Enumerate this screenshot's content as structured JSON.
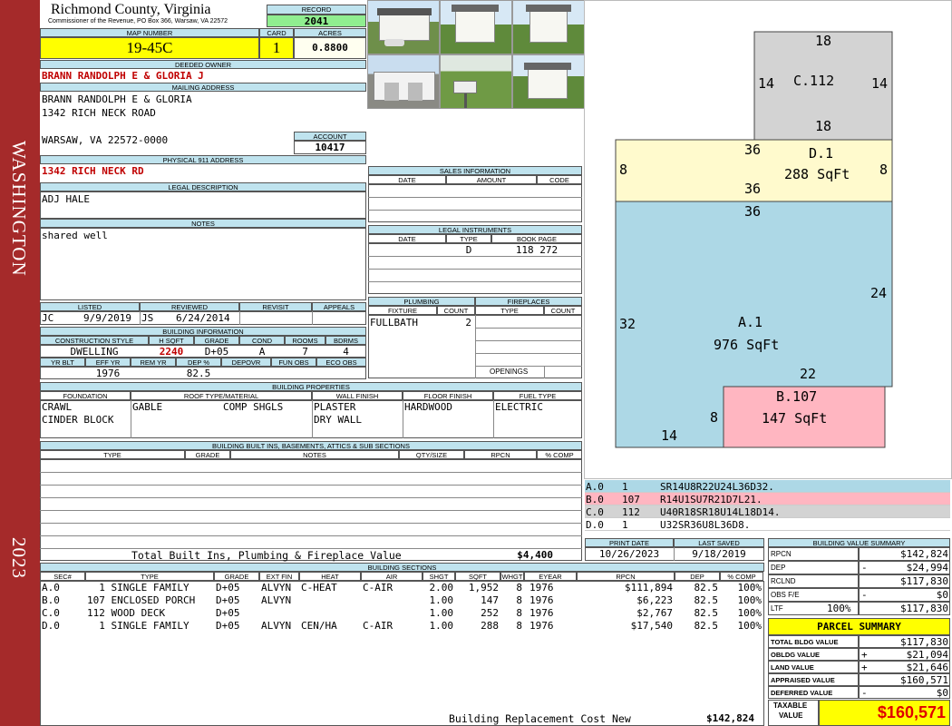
{
  "sidebar": {
    "location": "WASHINGTON",
    "year": "2023",
    "color": "#a52a2a"
  },
  "header": {
    "county": "Richmond County, Virginia",
    "commissioner": "Commissioner of the Revenue, PO Box 366, Warsaw, VA 22572",
    "record_label": "RECORD",
    "record": "2041",
    "map_label": "MAP NUMBER",
    "map_number": "19-45C",
    "card_label": "CARD",
    "card": "1",
    "acres_label": "ACRES",
    "acres": "0.8800"
  },
  "owner": {
    "deeded_label": "DEEDED OWNER",
    "deeded_owner": "BRANN RANDOLPH E & GLORIA J",
    "mailing_label": "MAILING ADDRESS",
    "mailing_lines": [
      "BRANN RANDOLPH E & GLORIA",
      "1342 RICH NECK ROAD",
      "WARSAW, VA 22572-0000"
    ],
    "account_label": "ACCOUNT",
    "account": "10417",
    "physical_label": "PHYSICAL 911 ADDRESS",
    "physical": "1342 RICH NECK RD",
    "legal_label": "LEGAL DESCRIPTION",
    "legal": "ADJ HALE",
    "notes_label": "NOTES",
    "notes": "shared well"
  },
  "review": {
    "headers": [
      "LISTED",
      "REVIEWED",
      "REVISIT",
      "APPEALS"
    ],
    "listed_by": "JC",
    "listed_date": "9/9/2019",
    "reviewed_by": "JS",
    "reviewed_date": "6/24/2014"
  },
  "building_info": {
    "label": "BUILDING INFORMATION",
    "headers1": [
      "CONSTRUCTION STYLE",
      "H SQFT",
      "GRADE",
      "COND",
      "ROOMS",
      "BDRMS"
    ],
    "style": "DWELLING",
    "hsqft": "2240",
    "grade": "D+05",
    "cond": "A",
    "rooms": "7",
    "bdrms": "4",
    "headers2": [
      "YR BLT",
      "EFF YR",
      "REM YR",
      "DEP %",
      "DEPOVR",
      "FUN OBS",
      "ECO OBS"
    ],
    "eff_yr": "1976",
    "dep_pct": "82.5"
  },
  "sales": {
    "label": "SALES INFORMATION",
    "headers": [
      "DATE",
      "AMOUNT",
      "CODE"
    ]
  },
  "legal_instruments": {
    "label": "LEGAL INSTRUMENTS",
    "headers": [
      "DATE",
      "TYPE",
      "BOOK PAGE"
    ],
    "rows": [
      {
        "type": "D",
        "book_page": "118 272"
      }
    ]
  },
  "plumbing": {
    "label": "PLUMBING",
    "headers": [
      "FIXTURE",
      "COUNT"
    ],
    "fixture": "FULLBATH",
    "count": "2"
  },
  "fireplaces": {
    "label": "FIREPLACES",
    "headers": [
      "TYPE",
      "COUNT"
    ],
    "openings_label": "OPENINGS"
  },
  "properties": {
    "label": "BUILDING PROPERTIES",
    "headers": [
      "FOUNDATION",
      "ROOF TYPE/MATERIAL",
      "WALL FINISH",
      "FLOOR FINISH",
      "FUEL TYPE"
    ],
    "foundation": [
      "CRAWL",
      "CINDER BLOCK"
    ],
    "roof_type": "GABLE",
    "roof_material": "COMP SHGLS",
    "wall": [
      "PLASTER",
      "DRY WALL"
    ],
    "floor": "HARDWOOD",
    "fuel": "ELECTRIC"
  },
  "builtins": {
    "label": "BUILDING BUILT INS, BASEMENTS, ATTICS & SUB SECTIONS",
    "headers": [
      "TYPE",
      "GRADE",
      "NOTES",
      "QTY/SIZE",
      "RPCN",
      "% COMP"
    ],
    "total_label": "Total Built Ins, Plumbing & Fireplace Value",
    "total_value": "$4,400"
  },
  "dates": {
    "print_label": "PRINT DATE",
    "print_date": "10/26/2023",
    "saved_label": "LAST SAVED",
    "saved_date": "9/18/2019"
  },
  "sections": {
    "label": "BUILDING SECTIONS",
    "headers": [
      "SEC#",
      "TYPE",
      "GRADE",
      "EXT FIN",
      "HEAT",
      "AIR",
      "SHGT",
      "SQFT",
      "WHGT",
      "EYEAR",
      "RPCN",
      "DEP",
      "% COMP"
    ],
    "rows": [
      {
        "sec": "A.0",
        "type": "  1 SINGLE FAMILY",
        "grade": "D+05",
        "ext": "ALVYN",
        "heat": "C-HEAT",
        "air": "C-AIR",
        "shgt": "2.00",
        "sqft": "1,952",
        "whgt": "8",
        "eyear": "1976",
        "rpcn": "$111,894",
        "dep": "82.5",
        "comp": "100%"
      },
      {
        "sec": "B.0",
        "type": "107 ENCLOSED PORCH",
        "grade": "D+05",
        "ext": "ALVYN",
        "heat": "",
        "air": "",
        "shgt": "1.00",
        "sqft": "147",
        "whgt": "8",
        "eyear": "1976",
        "rpcn": "$6,223",
        "dep": "82.5",
        "comp": "100%"
      },
      {
        "sec": "C.0",
        "type": "112 WOOD DECK",
        "grade": "D+05",
        "ext": "",
        "heat": "",
        "air": "",
        "shgt": "1.00",
        "sqft": "252",
        "whgt": "8",
        "eyear": "1976",
        "rpcn": "$2,767",
        "dep": "82.5",
        "comp": "100%"
      },
      {
        "sec": "D.0",
        "type": "  1 SINGLE FAMILY",
        "grade": "D+05",
        "ext": "ALVYN",
        "heat": "CEN/HA",
        "air": "C-AIR",
        "shgt": "1.00",
        "sqft": "288",
        "whgt": "8",
        "eyear": "1976",
        "rpcn": "$17,540",
        "dep": "82.5",
        "comp": "100%"
      }
    ],
    "replacement_label": "Building Replacement Cost New",
    "replacement_value": "$142,824"
  },
  "sketch": {
    "areas": [
      {
        "code": "A.1",
        "sqft": "976 SqFt",
        "color": "#add8e6"
      },
      {
        "code": "B.107",
        "sqft": "147 SqFt",
        "color": "#ffb6c1"
      },
      {
        "code": "C.112",
        "color": "#d3d3d3"
      },
      {
        "code": "D.1",
        "sqft": "288 SqFt",
        "color": "#fffacd"
      }
    ],
    "dims": [
      "18",
      "14",
      "14",
      "18",
      "36",
      "8",
      "8",
      "36",
      "36",
      "24",
      "32",
      "22",
      "8",
      "14"
    ],
    "legend": [
      {
        "sec": "A.0",
        "num": "1",
        "code": "SR14U8R22U24L36D32.",
        "color": "#add8e6"
      },
      {
        "sec": "B.0",
        "num": "107",
        "code": "R14U1SU7R21D7L21.",
        "color": "#ffb6c1"
      },
      {
        "sec": "C.0",
        "num": "112",
        "code": "U40R18SR18U14L18D14.",
        "color": "#d3d3d3"
      },
      {
        "sec": "D.0",
        "num": "1",
        "code": "U32SR36U8L36D8.",
        "color": "#ffffff"
      }
    ]
  },
  "value_summary": {
    "label": "BUILDING VALUE SUMMARY",
    "rows": [
      {
        "label": "RPCN",
        "sign": "",
        "value": "$142,824"
      },
      {
        "label": "DEP",
        "sign": "-",
        "value": "$24,994"
      },
      {
        "label": "RCLND",
        "sign": "",
        "value": "$117,830"
      },
      {
        "label": "OBS F/E",
        "sign": "-",
        "value": "$0"
      },
      {
        "label": "LTF",
        "pct": "100%",
        "sign": "",
        "value": "$117,830"
      }
    ]
  },
  "parcel": {
    "label": "PARCEL SUMMARY",
    "rows": [
      {
        "label": "TOTAL BLDG VALUE",
        "sign": "",
        "value": "$117,830"
      },
      {
        "label": "OBLDG VALUE",
        "sign": "+",
        "value": "$21,094"
      },
      {
        "label": "LAND VALUE",
        "sign": "+",
        "value": "$21,646"
      },
      {
        "label": "APPRAISED VALUE",
        "sign": "",
        "value": "$160,571"
      },
      {
        "label": "DEFERRED VALUE",
        "sign": "-",
        "value": "$0"
      }
    ],
    "taxable_label_1": "TAXABLE",
    "taxable_label_2": "VALUE",
    "taxable_value": "$160,571"
  }
}
